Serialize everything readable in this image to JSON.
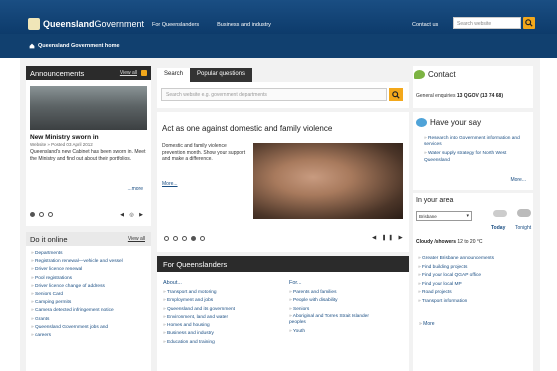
{
  "header": {
    "logo_strong": "Queensland",
    "logo_light": "Government",
    "nav": [
      "For Queenslanders",
      "Business and industry"
    ],
    "contact_link": "Contact us",
    "search_placeholder": "Search website",
    "home_link": "Queensland Government home"
  },
  "announcements": {
    "title": "Announcements",
    "view_all": "View all",
    "item_title": "New Ministry sworn in",
    "item_meta": "Website » Posted 03 April 2012",
    "item_body": "Queensland's new Cabinet has been sworn in. Meet the Ministry and find out about their portfolios.",
    "more": "...more"
  },
  "do_online": {
    "title": "Do it online",
    "view_all": "View all",
    "items": [
      "Departments",
      "Registration renewal—vehicle and vessel",
      "Driver licence renewal",
      "Pool registrations",
      "Driver licence change of address",
      "Seniors Card",
      "Camping permits",
      "Camera detected infringement notice",
      "Grants",
      "Queensland Government jobs and",
      "careers"
    ]
  },
  "center": {
    "tabs": [
      "Search",
      "Popular questions"
    ],
    "search_placeholder": "Search website e.g. government departments",
    "feature_title": "Act as one against domestic and family violence",
    "feature_text": "Domestic and family violence prevention month. Show your support and make a difference.",
    "feature_more": "More..."
  },
  "for_queenslanders": {
    "title": "For Queenslanders",
    "col1_head": "About...",
    "col1": [
      "Transport and motoring",
      "Employment and jobs",
      "Queensland and its government",
      "Environment, land and water",
      "Homes and housing",
      "Business and industry",
      "Education and training"
    ],
    "col2_head": "For...",
    "col2": [
      "Parents and families",
      "People with disability",
      "Seniors",
      "Aboriginal and Torres Strait Islander peoples",
      "Youth"
    ]
  },
  "contact": {
    "title": "Contact",
    "line_label": "General enquiries",
    "line_value": "13 QGOV (13 74 68)"
  },
  "have_say": {
    "title": "Have your say",
    "items": [
      "Research into Government information and services",
      "Water supply strategy for North West Queensland"
    ],
    "more": "More..."
  },
  "in_area": {
    "title": "In your area",
    "location": "Brisbane",
    "day_today": "Today",
    "day_tonight": "Tonight",
    "forecast_bold": "Cloudy /showers",
    "forecast_temp": "12 to 20 °C",
    "links": [
      "Greater Brisbane announcements",
      "Find building projects",
      "Find your local QGAP office",
      "Find your local MP",
      "Road projects",
      "Transport information"
    ],
    "more": "More"
  }
}
